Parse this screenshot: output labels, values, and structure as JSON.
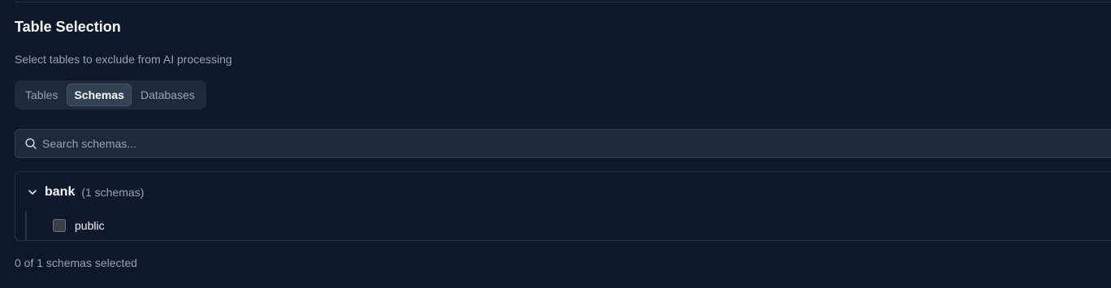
{
  "section": {
    "title": "Table Selection",
    "subtitle": "Select tables to exclude from AI processing"
  },
  "tabs": [
    {
      "label": "Tables",
      "active": false
    },
    {
      "label": "Schemas",
      "active": true
    },
    {
      "label": "Databases",
      "active": false
    }
  ],
  "search": {
    "placeholder": "Search schemas...",
    "value": "",
    "icon": "search-icon"
  },
  "tree": {
    "group": {
      "name": "bank",
      "count_label": "(1 schemas)",
      "expanded": true,
      "icon": "chevron-down-icon"
    },
    "items": [
      {
        "label": "public",
        "checked": false
      }
    ]
  },
  "status": {
    "selection_text": "0 of 1 schemas selected"
  },
  "colors": {
    "background": "#0f172a",
    "surface": "#1e293b",
    "border": "#334155",
    "text_primary": "#f8fafc",
    "text_muted": "#94a3b8"
  }
}
